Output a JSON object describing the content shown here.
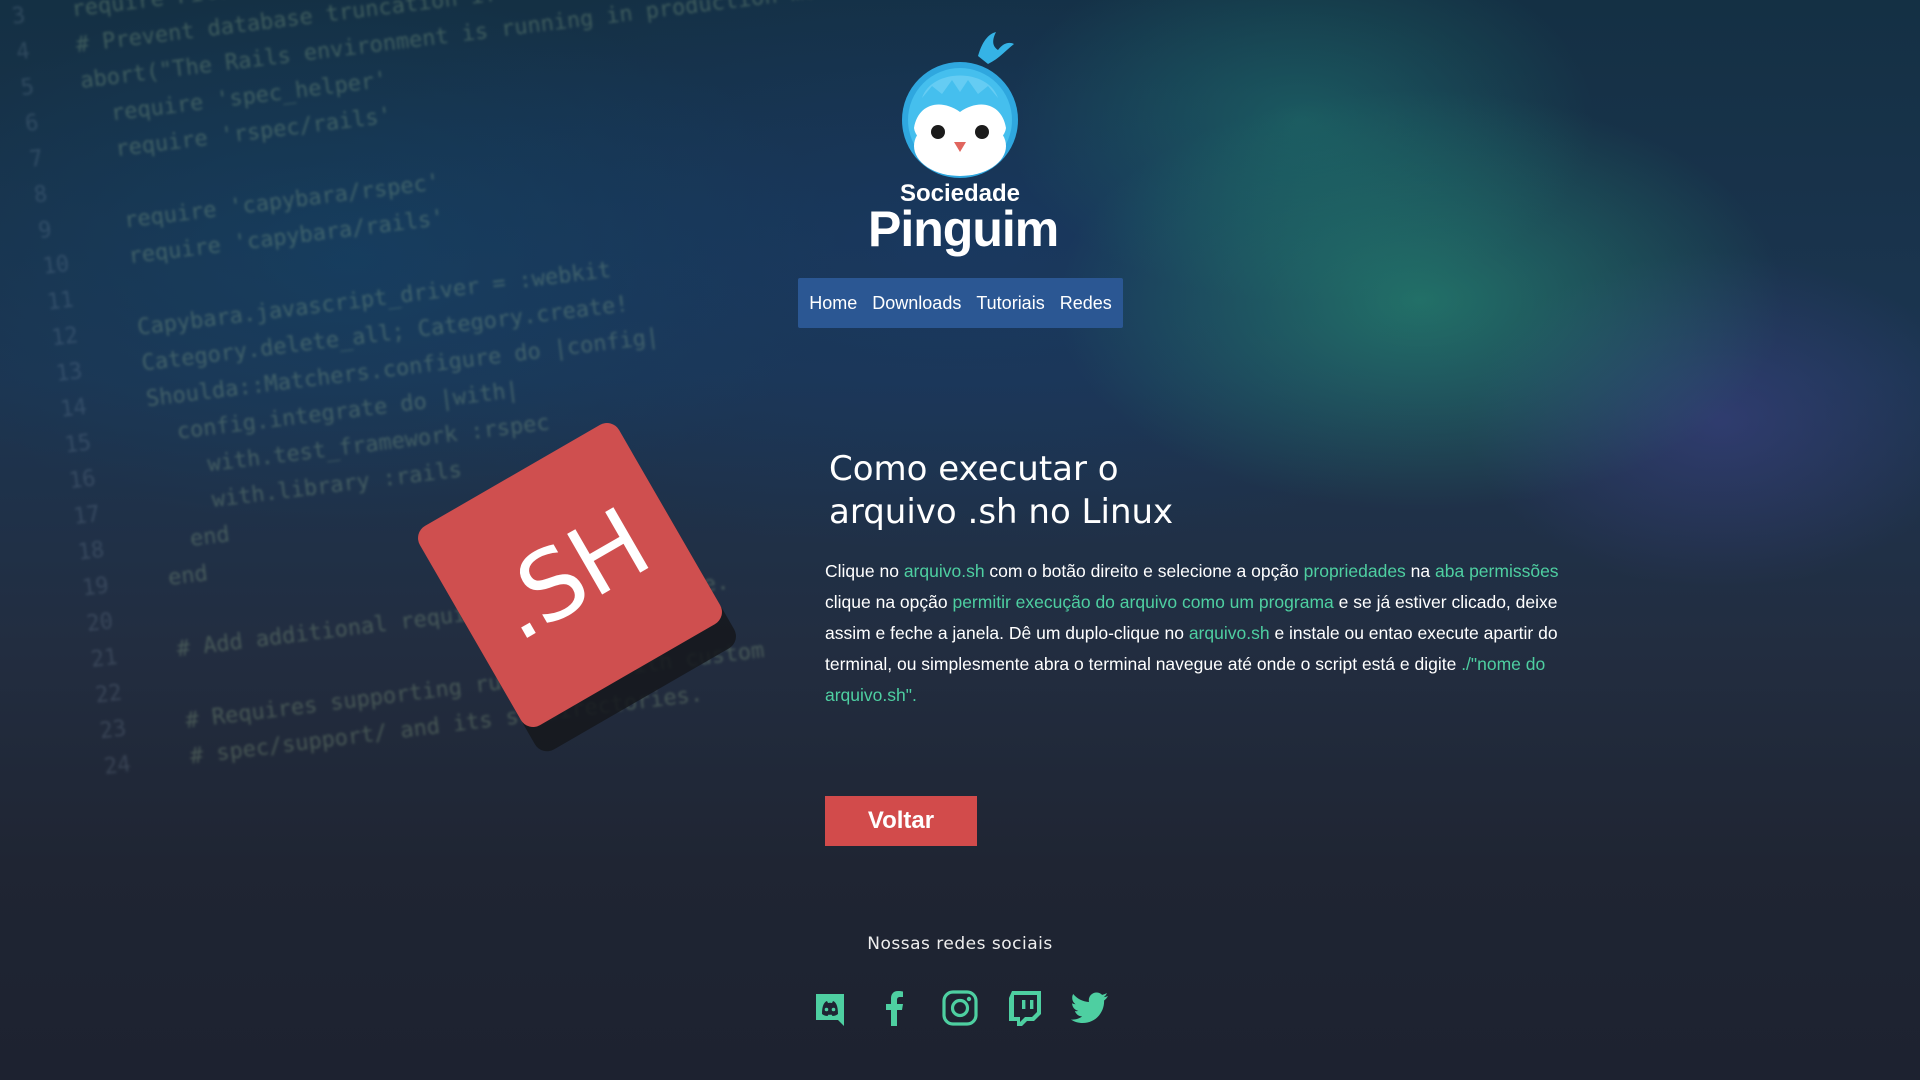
{
  "brand": {
    "line1": "Sociedade",
    "line2": "Pinguim"
  },
  "nav": {
    "items": [
      "Home",
      "Downloads",
      "Tutoriais",
      "Redes"
    ]
  },
  "hero_badge": ".SH",
  "article": {
    "title": "Como executar o arquivo .sh no Linux",
    "p": [
      "Clique no ",
      "arquivo.sh",
      " com o botão direito e selecione a opção ",
      "propriedades",
      " na ",
      "aba permissões",
      " clique na opção ",
      "permitir execução do  arquivo como um programa",
      " e se já estiver clicado, deixe assim e feche a janela. Dê um duplo-clique no ",
      "arquivo.sh",
      " e instale ou entao execute apartir do terminal, ou simplesmente abra o terminal navegue até onde o script está e digite ",
      "./\"nome do arquivo.sh\"."
    ]
  },
  "back_button": "Voltar",
  "social": {
    "title": "Nossas redes sociais",
    "icons": [
      "discord-icon",
      "facebook-icon",
      "instagram-icon",
      "twitch-icon",
      "twitter-icon"
    ],
    "color": "#4ecfa1"
  },
  "colors": {
    "accent": "#4ecfa1",
    "nav": "#2b5793",
    "button": "#d24b4b",
    "badge": "#cf4f4f"
  }
}
